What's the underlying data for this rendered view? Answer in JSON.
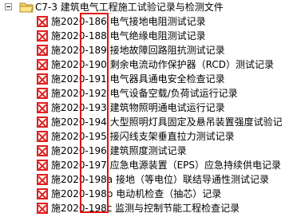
{
  "tree": {
    "folder": {
      "label": "C7-3 建筑电气工程施工试验记录与检测文件",
      "expanded": true,
      "icon": "folder-open-icon"
    },
    "items": [
      {
        "label": "施2020-186 电气接地电阻测试记录"
      },
      {
        "label": "施2020-188 电气绝缘电阻测试记录"
      },
      {
        "label": "施2020-189 接地故障回路阻抗测试记录"
      },
      {
        "label": "施2020-190 剩余电流动作保护器（RCD）测试记录"
      },
      {
        "label": "施2020-191 电气器具通电安全检查记录"
      },
      {
        "label": "施2020-192 电气设备空载/负荷试运行记录"
      },
      {
        "label": "施2020-193 建筑物照明通电试运行记录"
      },
      {
        "label": "施2020-194 大型照明灯具固定及悬吊装置强度试验记"
      },
      {
        "label": "施2020-195 接闪线支架垂直拉力测试记录"
      },
      {
        "label": "施2020-196 建筑照度测试记录"
      },
      {
        "label": "施2020-197 应急电源装置（EPS）应急持续供电记录"
      },
      {
        "label": "施2020-198a 接地（等电位）联结导通性测试记录"
      },
      {
        "label": "施2020-198b 电动机检查（抽芯）记录"
      },
      {
        "label": "施2020-198c 监测与控制节能工程检查记录"
      }
    ],
    "item_icon": "pdf-file-icon"
  },
  "colors": {
    "highlight": "#e01010",
    "file_icon": "#e02020"
  }
}
